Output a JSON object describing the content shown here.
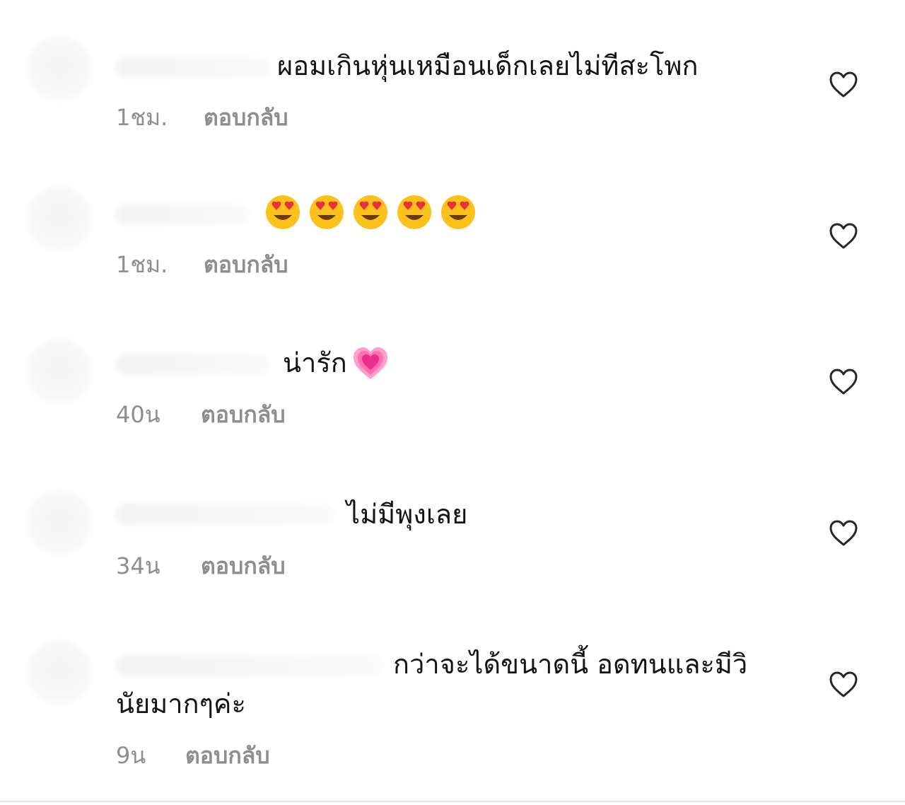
{
  "comments": [
    {
      "text": "ผอมเกินหุ่นเหมือนเด็กเลยไม่ทีสะโพก",
      "time": "1ชม.",
      "reply_label": "ตอบกลับ",
      "like_icon": "heart-outline-icon"
    },
    {
      "text": "",
      "emojis": [
        "heart-eyes-emoji",
        "heart-eyes-emoji",
        "heart-eyes-emoji",
        "heart-eyes-emoji",
        "heart-eyes-emoji"
      ],
      "time": "1ชม.",
      "reply_label": "ตอบกลับ",
      "like_icon": "heart-outline-icon"
    },
    {
      "text": "น่ารัก",
      "emoji": "growing-heart-emoji",
      "time": "40น",
      "reply_label": "ตอบกลับ",
      "like_icon": "heart-outline-icon"
    },
    {
      "text": "ไม่มีพุงเลย",
      "time": "34น",
      "reply_label": "ตอบกลับ",
      "like_icon": "heart-outline-icon"
    },
    {
      "text_line1": "กว่าจะได้ขนาดนี้ อดทนและมีวิ",
      "text_line2": "นัยมากๆค่ะ",
      "time": "9น",
      "reply_label": "ตอบกลับ",
      "like_icon": "heart-outline-icon"
    }
  ],
  "colors": {
    "text": "#141414",
    "meta": "#8e8e8e",
    "heart_stroke": "#262626",
    "pink_heart": "#ff5fa8"
  }
}
